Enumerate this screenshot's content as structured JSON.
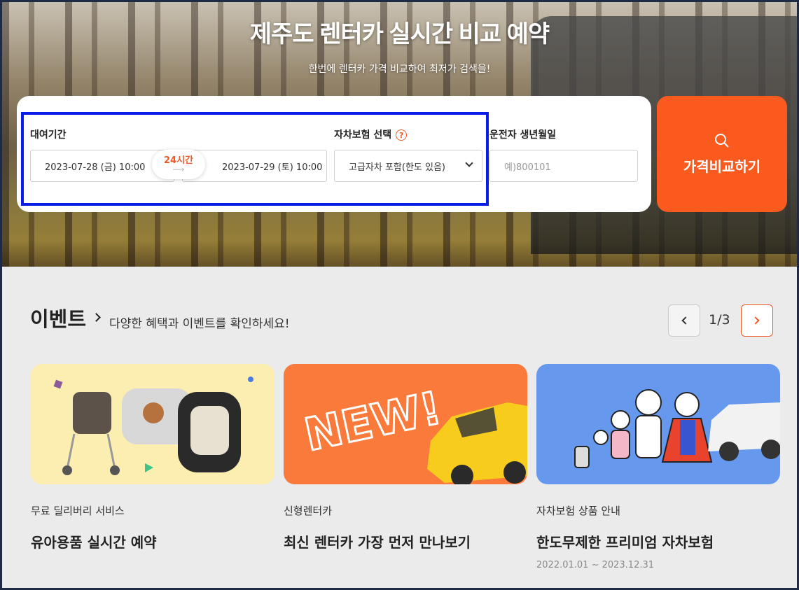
{
  "hero": {
    "title": "제주도 렌터카 실시간 비교 예약",
    "subtitle": "한번에 렌터카 가격 비교하여 최저가 검색을!"
  },
  "search": {
    "period_label": "대여기간",
    "start_value": "2023-07-28 (금) 10:00",
    "end_value": "2023-07-29 (토) 10:00",
    "duration_badge": "24시간",
    "insurance_label": "자차보험 선택",
    "insurance_help": "?",
    "insurance_value": "고급자차 포함(한도 있음)",
    "birth_label": "운전자 생년월일",
    "birth_placeholder": "예)800101",
    "submit_label": "가격비교하기"
  },
  "events": {
    "title": "이벤트",
    "subtitle": "다양한 혜택과 이벤트를 확인하세요!",
    "pagination": "1/3",
    "cards": [
      {
        "category": "무료 딜리버리 서비스",
        "title": "유아용품 실시간 예약",
        "date": "",
        "bg": "#fbeeb0"
      },
      {
        "category": "신형렌터카",
        "title": "최신 렌터카 가장 먼저 만나보기",
        "date": "",
        "bg": "#fa7a3c",
        "art_text": "NEW!"
      },
      {
        "category": "자차보험 상품 안내",
        "title": "한도무제한 프리미엄 자차보험",
        "date": "2022.01.01 ~ 2023.12.31",
        "bg": "#6699ee"
      }
    ]
  },
  "colors": {
    "accent": "#fa5a1e",
    "highlight": "#0a1de6"
  }
}
